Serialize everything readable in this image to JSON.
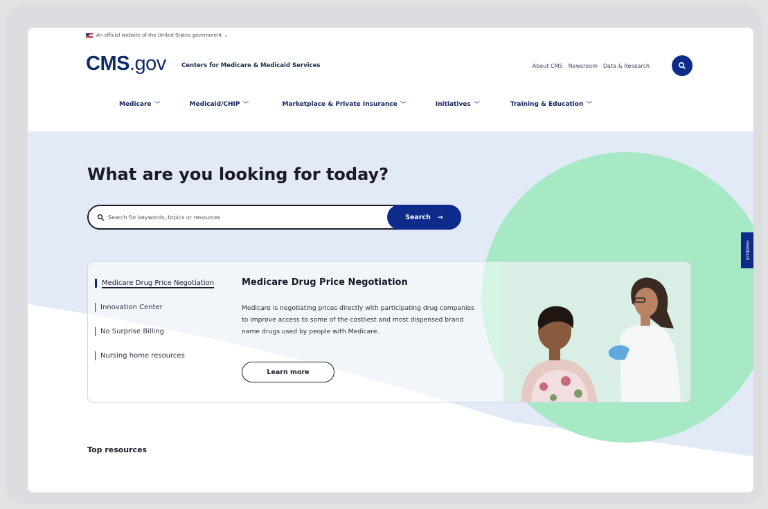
{
  "banner": {
    "text": "An official website of the United States government",
    "chevron": "⌄"
  },
  "header": {
    "logo_cms": "CMS",
    "logo_dotgov": ".gov",
    "tagline": "Centers for Medicare & Medicaid Services",
    "utility_links": [
      "About CMS",
      "Newsroom",
      "Data & Research"
    ]
  },
  "nav": {
    "items": [
      "Medicare",
      "Medicaid/CHIP",
      "Marketplace & Private Insurance",
      "Initiatives",
      "Training & Education"
    ]
  },
  "hero": {
    "title": "What are you looking for today?",
    "search_placeholder": "Search for keywords, topics or resources",
    "search_button": "Search",
    "search_arrow": "→"
  },
  "card": {
    "links": [
      "Medicare Drug Price Negotiation",
      "Innovation Center",
      "No Surprise Billing",
      "Nursing home resources"
    ],
    "title": "Medicare Drug Price Negotiation",
    "body": "Medicare is negotiating prices directly with participating drug companies to improve access to some of the costliest and most dispensed brand name drugs used by people with Medicare.",
    "learn_more": "Learn more"
  },
  "feedback": "Feedback",
  "top_resources": "Top resources",
  "colors": {
    "navy": "#0d2b8b",
    "hero_bg": "#e3eaf7",
    "green": "#a6e9c4"
  }
}
